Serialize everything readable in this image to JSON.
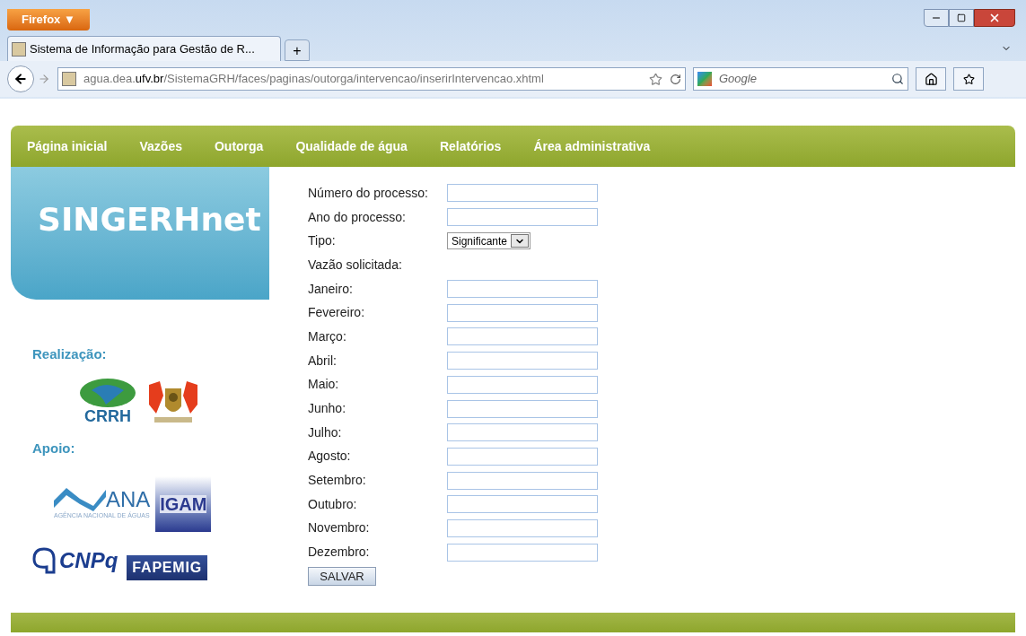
{
  "browser": {
    "menu_button": "Firefox ▼",
    "tab_title": "Sistema de Informação para Gestão de R...",
    "new_tab": "+",
    "url_prefix": "agua.dea.",
    "url_domain": "ufv.br",
    "url_path": "/SistemaGRH/faces/paginas/outorga/intervencao/inserirIntervencao.xhtml",
    "search_placeholder": "Google"
  },
  "nav": [
    {
      "label": "Página inicial",
      "selected": false
    },
    {
      "label": "Vazões",
      "selected": false
    },
    {
      "label": "Outorga",
      "selected": false
    },
    {
      "label": "Qualidade de água",
      "selected": false
    },
    {
      "label": "Relatórios",
      "selected": false
    },
    {
      "label": "Área administrativa",
      "selected": false
    }
  ],
  "sidebar": {
    "brand": "SINGERHnet",
    "realizacao": "Realização:",
    "crrh": "CRRH",
    "apoio": "Apoio:",
    "ana": "ANA",
    "ana_sub": "AGÊNCIA NACIONAL DE ÁGUAS",
    "igam": "IGAM",
    "cnpq": "CNPq",
    "fapemig": "FAPEMIG"
  },
  "form": {
    "fields": [
      {
        "kind": "text",
        "label": "Número do processo:"
      },
      {
        "kind": "text",
        "label": "Ano do processo:"
      },
      {
        "kind": "select",
        "label": "Tipo:",
        "value": "Significante"
      },
      {
        "kind": "heading",
        "label": "Vazão solicitada:"
      },
      {
        "kind": "text",
        "label": "Janeiro:"
      },
      {
        "kind": "text",
        "label": "Fevereiro:"
      },
      {
        "kind": "text",
        "label": "Março:"
      },
      {
        "kind": "text",
        "label": "Abril:"
      },
      {
        "kind": "text",
        "label": "Maio:"
      },
      {
        "kind": "text",
        "label": "Junho:"
      },
      {
        "kind": "text",
        "label": "Julho:"
      },
      {
        "kind": "text",
        "label": "Agosto:"
      },
      {
        "kind": "text",
        "label": "Setembro:"
      },
      {
        "kind": "text",
        "label": "Outubro:"
      },
      {
        "kind": "text",
        "label": "Novembro:"
      },
      {
        "kind": "text",
        "label": "Dezembro:"
      }
    ],
    "submit": "SALVAR"
  }
}
